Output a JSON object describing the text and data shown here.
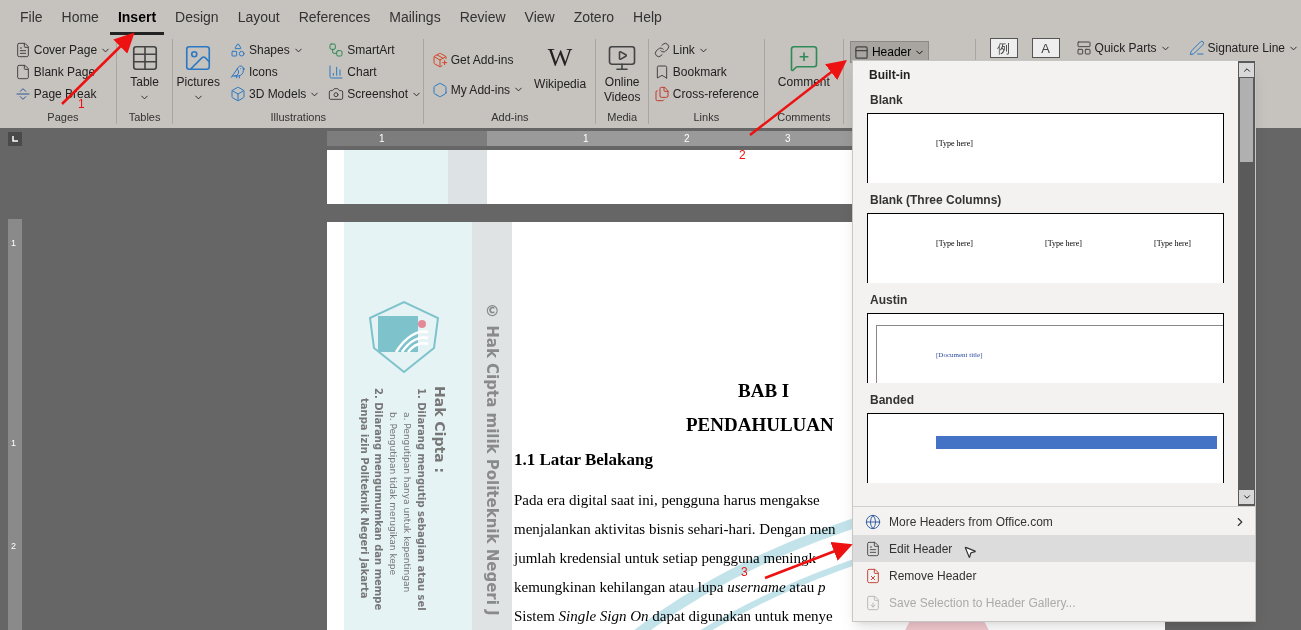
{
  "tabs": [
    {
      "label": "File",
      "selected": false
    },
    {
      "label": "Home",
      "selected": false
    },
    {
      "label": "Insert",
      "selected": true
    },
    {
      "label": "Design",
      "selected": false
    },
    {
      "label": "Layout",
      "selected": false
    },
    {
      "label": "References",
      "selected": false
    },
    {
      "label": "Mailings",
      "selected": false
    },
    {
      "label": "Review",
      "selected": false
    },
    {
      "label": "View",
      "selected": false
    },
    {
      "label": "Zotero",
      "selected": false
    },
    {
      "label": "Help",
      "selected": false
    }
  ],
  "ribbon": {
    "groups": [
      {
        "label": "Pages",
        "columns": [
          [
            {
              "kind": "small",
              "label": "Cover Page",
              "dropdown": true
            },
            {
              "kind": "small",
              "label": "Blank Page",
              "dropdown": false
            },
            {
              "kind": "small",
              "label": "Page Break",
              "dropdown": false
            }
          ]
        ]
      },
      {
        "label": "Tables",
        "columns": [
          [
            {
              "kind": "large",
              "label": "Table",
              "dropdown": true
            }
          ]
        ]
      },
      {
        "label": "Illustrations",
        "columns": [
          [
            {
              "kind": "large",
              "label": "Pictures",
              "dropdown": true
            }
          ],
          [
            {
              "kind": "small",
              "label": "Shapes",
              "dropdown": true
            },
            {
              "kind": "small",
              "label": "Icons",
              "dropdown": false
            },
            {
              "kind": "small",
              "label": "3D Models",
              "dropdown": true
            }
          ],
          [
            {
              "kind": "small",
              "label": "SmartArt",
              "dropdown": false
            },
            {
              "kind": "small",
              "label": "Chart",
              "dropdown": false
            },
            {
              "kind": "small",
              "label": "Screenshot",
              "dropdown": true
            }
          ]
        ]
      },
      {
        "label": "Add-ins",
        "columns": [
          [
            {
              "kind": "small",
              "label": "Get Add-ins",
              "dropdown": false
            },
            {
              "kind": "small",
              "label": "My Add-ins",
              "dropdown": true
            }
          ],
          [
            {
              "kind": "large",
              "label": "Wikipedia",
              "dropdown": false,
              "glyph": "W"
            }
          ]
        ]
      },
      {
        "label": "Media",
        "columns": [
          [
            {
              "kind": "large",
              "label": "Online Videos",
              "dropdown": false
            }
          ]
        ]
      },
      {
        "label": "Links",
        "columns": [
          [
            {
              "kind": "small",
              "label": "Link",
              "dropdown": true
            },
            {
              "kind": "small",
              "label": "Bookmark",
              "dropdown": false
            },
            {
              "kind": "small",
              "label": "Cross-reference",
              "dropdown": false
            }
          ]
        ]
      },
      {
        "label": "Comments",
        "columns": [
          [
            {
              "kind": "large",
              "label": "Comment",
              "dropdown": false
            }
          ]
        ]
      }
    ],
    "header_button": {
      "label": "Header",
      "dropdown": true,
      "pressed": true
    },
    "more": [
      {
        "kind": "glyph",
        "glyph": "例"
      },
      {
        "kind": "glyph",
        "glyph": "A"
      },
      {
        "kind": "small",
        "label": "Quick Parts",
        "dropdown": true
      },
      {
        "kind": "small",
        "label": "Signature Line",
        "dropdown": true
      }
    ]
  },
  "rulers": {
    "horizontal": [
      "1",
      "1",
      "2",
      "3"
    ],
    "vertical": [
      "1",
      "1",
      "2"
    ]
  },
  "document": {
    "copyright": "© Hak Cipta milik Politeknik Negeri J",
    "notice": [
      "Hak Cipta :",
      "1. Dilarang mengutip sebagian atau sel",
      "a. Pengutipan hanya untuk kepentingan",
      "b. Pengutipan tidak merugikan kepe",
      "2. Dilarang mengumumkan dan mempe",
      "tanpa izin Politeknik Negeri Jakarta"
    ],
    "chapter": "BAB I",
    "chapter_title": "PENDAHULUAN",
    "section": "1.1 Latar Belakang",
    "lines": [
      "Pada era digital saat ini, pengguna harus mengakse",
      "menjalankan aktivitas bisnis sehari-hari. Dengan men",
      "jumlah kredensial untuk setiap pengguna meningk",
      "kemungkinan kehilangan atau lupa *username* atau *p*",
      "Sistem *Single Sign On* dapat digunakan untuk menye"
    ]
  },
  "header_menu": {
    "heading": "Built-in",
    "gallery": [
      {
        "name": "Blank",
        "kind": "blank",
        "placeholders": [
          "[Type here]"
        ]
      },
      {
        "name": "Blank (Three Columns)",
        "kind": "three_columns",
        "placeholders": [
          "[Type here]",
          "[Type here]",
          "[Type here]"
        ]
      },
      {
        "name": "Austin",
        "kind": "austin",
        "placeholders": [
          "[Document title]"
        ]
      },
      {
        "name": "Banded",
        "kind": "banded"
      }
    ],
    "items": [
      {
        "label": "More Headers from Office.com",
        "submenu": true,
        "highlighted": false,
        "disabled": false
      },
      {
        "label": "Edit Header",
        "submenu": false,
        "highlighted": true,
        "disabled": false
      },
      {
        "label": "Remove Header",
        "submenu": false,
        "highlighted": false,
        "disabled": false
      },
      {
        "label": "Save Selection to Header Gallery...",
        "submenu": false,
        "highlighted": false,
        "disabled": true
      }
    ]
  },
  "annotations": [
    {
      "label": "1"
    },
    {
      "label": "2"
    },
    {
      "label": "3"
    }
  ]
}
